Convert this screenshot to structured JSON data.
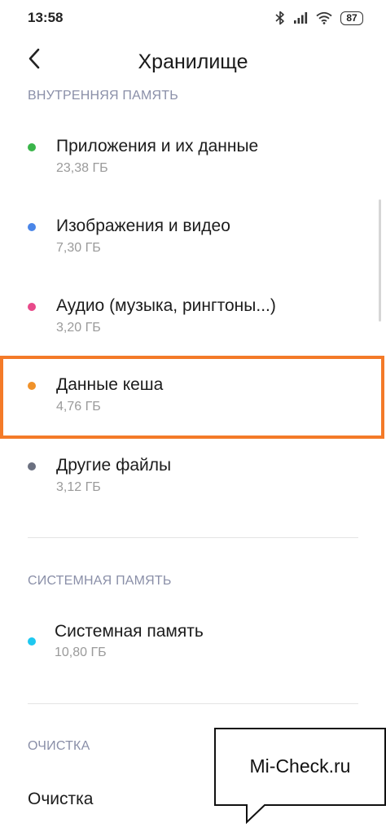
{
  "status_bar": {
    "time": "13:58",
    "battery": "87"
  },
  "header": {
    "title": "Хранилище"
  },
  "internal": {
    "section_label": "ВНУТРЕННЯЯ ПАМЯТЬ",
    "items": [
      {
        "label": "Приложения и их данные",
        "size": "23,38 ГБ",
        "color": "#3ab54a"
      },
      {
        "label": "Изображения и видео",
        "size": "7,30 ГБ",
        "color": "#4a86e8"
      },
      {
        "label": "Аудио (музыка, рингтоны...)",
        "size": "3,20 ГБ",
        "color": "#e84a8a"
      },
      {
        "label": "Данные кеша",
        "size": "4,76 ГБ",
        "color": "#f0922a"
      },
      {
        "label": "Другие файлы",
        "size": "3,12 ГБ",
        "color": "#6b7080"
      }
    ]
  },
  "system": {
    "section_label": "СИСТЕМНАЯ ПАМЯТЬ",
    "item": {
      "label": "Системная память",
      "size": "10,80 ГБ",
      "color": "#1ec8f0"
    }
  },
  "cleanup": {
    "section_label": "ОЧИСТКА",
    "item_label": "Очистка"
  },
  "watermark": {
    "text": "Mi-Check.ru"
  },
  "colors": {
    "highlight": "#f47a28",
    "section_header": "#8a8fa8"
  }
}
